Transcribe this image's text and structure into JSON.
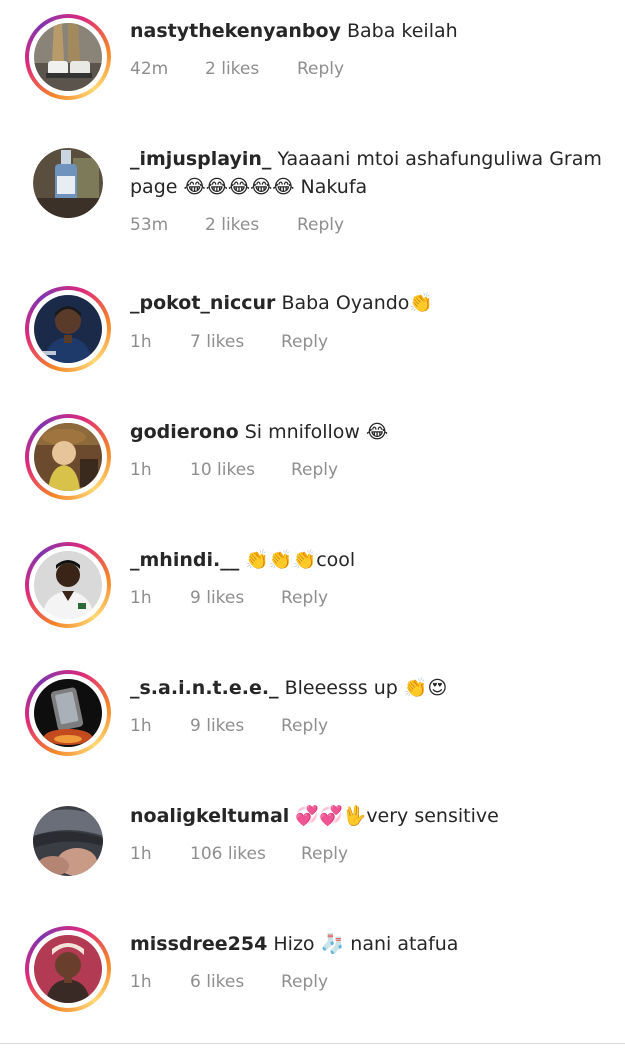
{
  "comments": [
    {
      "username": "nastythekenyanboy",
      "text": "Baba keilah",
      "time": "42m",
      "likes": "2 likes",
      "reply": "Reply",
      "avatar": "sneakers-photo"
    },
    {
      "username": "_imjusplayin_",
      "text": "Yaaaani mtoi ashafunguliwa Gram page 😂😂😂😂😂 Nakufa",
      "time": "53m",
      "likes": "2 likes",
      "reply": "Reply",
      "avatar": "bottle-photo"
    },
    {
      "username": "_pokot_niccur",
      "text": "Baba Oyando👏",
      "time": "1h",
      "likes": "7 likes",
      "reply": "Reply",
      "avatar": "man-portrait-photo"
    },
    {
      "username": "godierono",
      "text": "Si mnifollow 😂",
      "time": "1h",
      "likes": "10 likes",
      "reply": "Reply",
      "avatar": "cartoon-cowboy-photo"
    },
    {
      "username": "_mhindi.__",
      "text": "👏👏👏cool",
      "time": "1h",
      "likes": "9 likes",
      "reply": "Reply",
      "avatar": "man-white-shirt-photo"
    },
    {
      "username": "_s.a.i.n.t.e.e._",
      "text": "Bleeesss up 👏😍",
      "time": "1h",
      "likes": "9 likes",
      "reply": "Reply",
      "avatar": "phone-photo"
    },
    {
      "username": "noaligkeltumal",
      "text": "💞💞🖖very sensitive",
      "time": "1h",
      "likes": "106 likes",
      "reply": "Reply",
      "avatar": "fabric-photo"
    },
    {
      "username": "missdree254",
      "text": "Hizo 🧦 nani atafua",
      "time": "1h",
      "likes": "6 likes",
      "reply": "Reply",
      "avatar": "woman-portrait-photo"
    }
  ]
}
